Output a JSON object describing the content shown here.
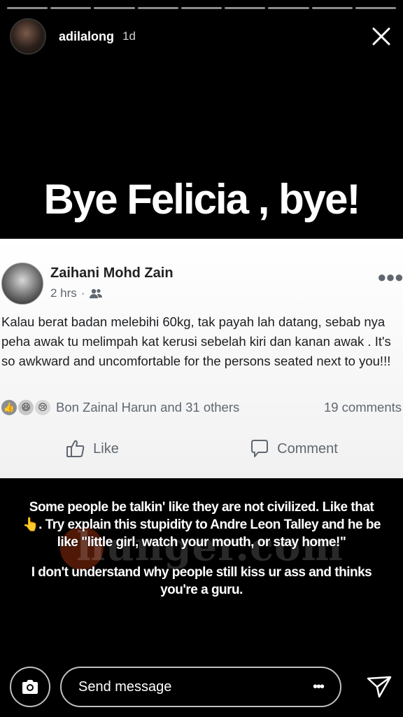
{
  "story": {
    "progress_segments": 9,
    "username": "adilalong",
    "time_ago": "1d",
    "headline": "Bye Felicia , bye!"
  },
  "post": {
    "author": "Zaihani Mohd Zain",
    "time": "2 hrs",
    "separator": "·",
    "body": "Kalau berat badan melebihi 60kg, tak payah lah datang, sebab nya peha awak tu melimpah kat kerusi sebelah kiri dan kanan awak . It's so awkward and uncomfortable for the persons seated next to you!!!",
    "reactions_text": "Bon Zainal Harun and 31 others",
    "comments_text": "19 comments",
    "like_label": "Like",
    "comment_label": "Comment"
  },
  "caption": {
    "line1": "Some people be talkin' like they are not civilized. Like that 👆. Try explain this stupidity to Andre Leon Talley and he be like \"little girl, watch your mouth, or stay home!\"",
    "line2": "I don't understand why people still kiss ur ass and thinks you're a guru."
  },
  "watermark": "hunger.com",
  "reply": {
    "placeholder": "Send message"
  }
}
